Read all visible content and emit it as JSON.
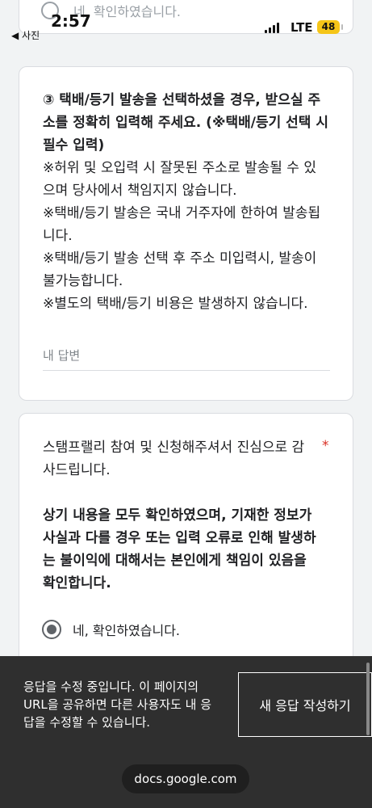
{
  "status_bar": {
    "time": "2:57",
    "back_label": "◀ 사진",
    "network": "LTE",
    "battery": "48"
  },
  "previous_question": {
    "option_label": "네, 확인하였습니다."
  },
  "address_question": {
    "title_lines": [
      "③ 택배/등기 발송을 선택하셨을 경우, 받으실 주",
      "소를 정확히 입력해 주세요. (※택배/등기 선택 시",
      "필수 입력)"
    ],
    "note_lines": [
      "※허위 및 오입력 시 잘못된 주소로 발송될 수 있",
      "으며 당사에서 책임지지 않습니다.",
      "※택배/등기 발송은 국내 거주자에 한하여 발송됩",
      "니다.",
      "※택배/등기 발송 선택 후 주소 미입력시, 발송이",
      "불가능합니다.",
      "※별도의 택배/등기 비용은 발생하지 않습니다."
    ],
    "answer_placeholder": "내 답변"
  },
  "confirm_question": {
    "title_lines": [
      "스탬프랠리 참여 및 신청해주셔서 진심으로 감",
      "사드립니다."
    ],
    "required_marker": "*",
    "bold_lines": [
      "상기 내용을 모두 확인하였으며, 기재한 정보가",
      "사실과 다를 경우 또는 입력 오류로 인해 발생하",
      "는 불이익에 대해서는 본인에게 책임이 있음을",
      "확인합니다."
    ],
    "option_label": "네, 확인하였습니다.",
    "option_selected": true
  },
  "edit_banner": {
    "message_lines": [
      "응답을 수정 중입니다. 이 페이지의",
      "URL을 공유하면 다른 사용자도 내 응",
      "답을 수정할 수 있습니다."
    ],
    "new_response_button": "새 응답 작성하기",
    "url": "docs.google.com"
  }
}
